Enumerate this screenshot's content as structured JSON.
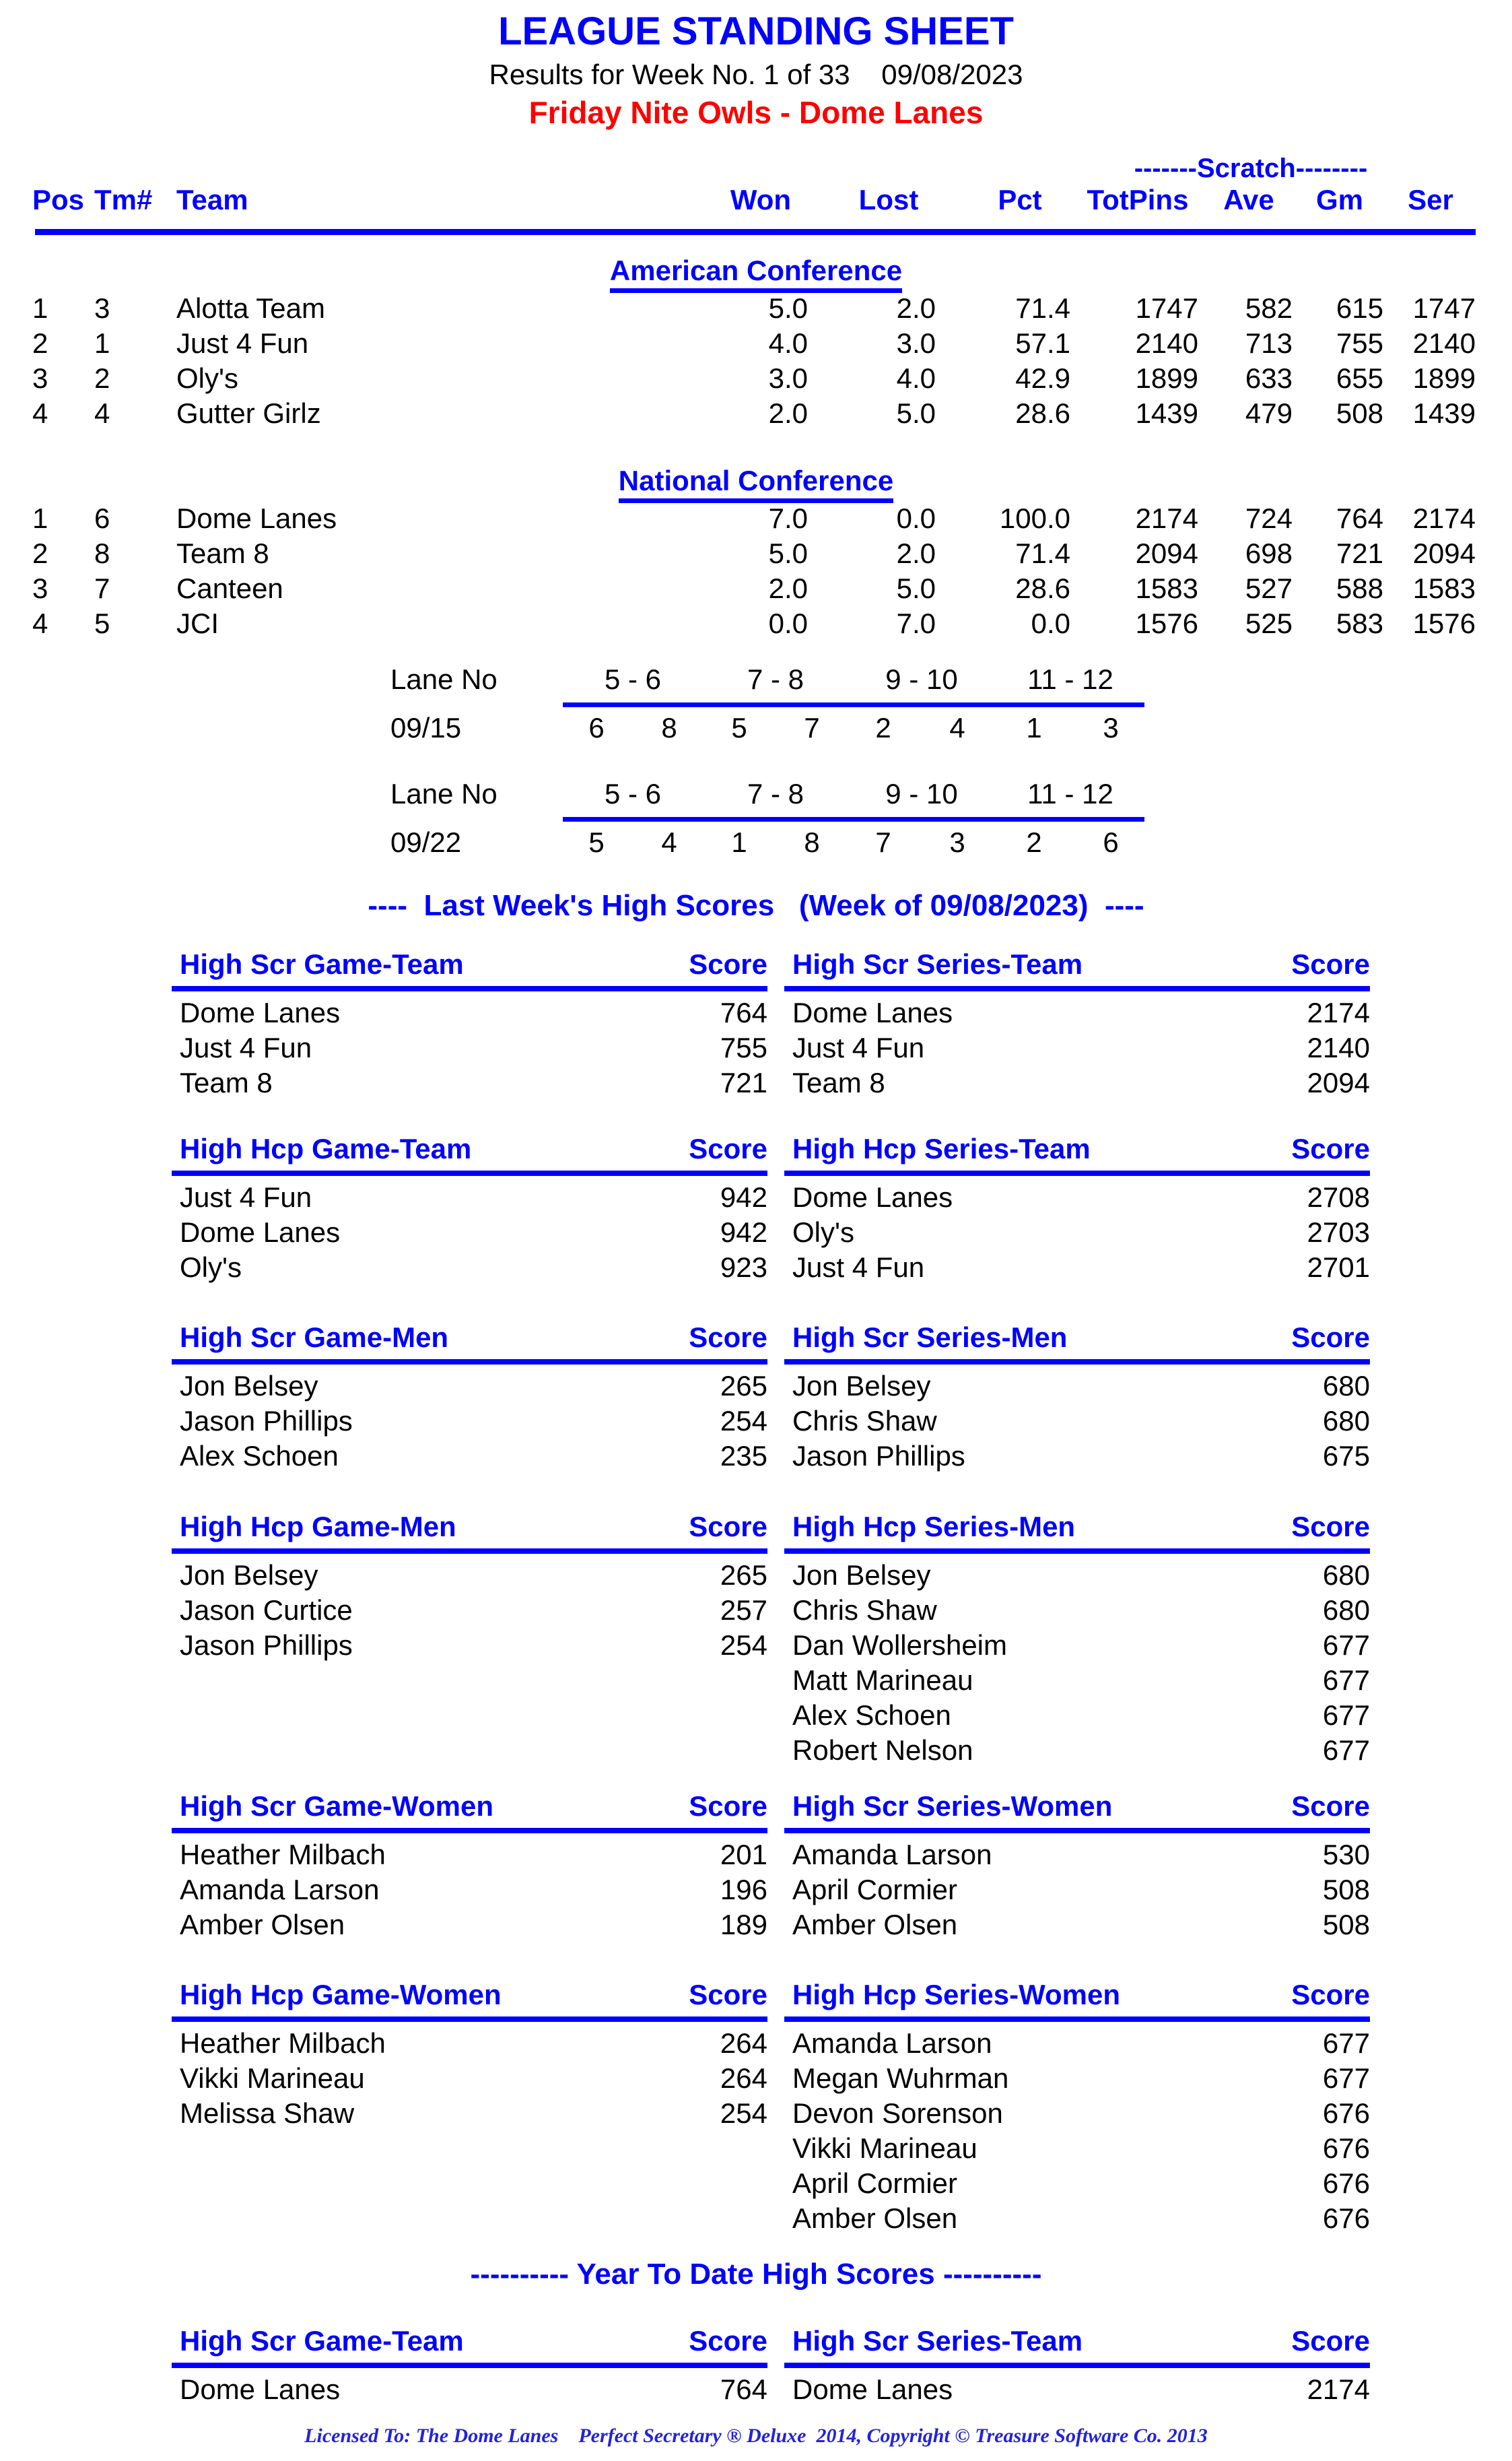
{
  "header": {
    "title": "LEAGUE STANDING SHEET",
    "subtitle": "Results for Week No. 1 of 33    09/08/2023",
    "league": "Friday Nite Owls - Dome Lanes"
  },
  "standings": {
    "scratch_label": "-------Scratch--------",
    "columns": {
      "pos": "Pos",
      "tm": "Tm#",
      "team": "Team",
      "won": "Won",
      "lost": "Lost",
      "pct": "Pct",
      "totpins": "TotPins",
      "ave": "Ave",
      "gm": "Gm",
      "ser": "Ser"
    },
    "conferences": [
      {
        "name": "American Conference",
        "rows": [
          {
            "pos": "1",
            "tm": "3",
            "team": "Alotta Team",
            "won": "5.0",
            "lost": "2.0",
            "pct": "71.4",
            "totpins": "1747",
            "ave": "582",
            "gm": "615",
            "ser": "1747"
          },
          {
            "pos": "2",
            "tm": "1",
            "team": "Just 4 Fun",
            "won": "4.0",
            "lost": "3.0",
            "pct": "57.1",
            "totpins": "2140",
            "ave": "713",
            "gm": "755",
            "ser": "2140"
          },
          {
            "pos": "3",
            "tm": "2",
            "team": "Oly's",
            "won": "3.0",
            "lost": "4.0",
            "pct": "42.9",
            "totpins": "1899",
            "ave": "633",
            "gm": "655",
            "ser": "1899"
          },
          {
            "pos": "4",
            "tm": "4",
            "team": "Gutter Girlz",
            "won": "2.0",
            "lost": "5.0",
            "pct": "28.6",
            "totpins": "1439",
            "ave": "479",
            "gm": "508",
            "ser": "1439"
          }
        ]
      },
      {
        "name": "National Conference",
        "rows": [
          {
            "pos": "1",
            "tm": "6",
            "team": "Dome Lanes",
            "won": "7.0",
            "lost": "0.0",
            "pct": "100.0",
            "totpins": "2174",
            "ave": "724",
            "gm": "764",
            "ser": "2174"
          },
          {
            "pos": "2",
            "tm": "8",
            "team": "Team 8",
            "won": "5.0",
            "lost": "2.0",
            "pct": "71.4",
            "totpins": "2094",
            "ave": "698",
            "gm": "721",
            "ser": "2094"
          },
          {
            "pos": "3",
            "tm": "7",
            "team": "Canteen",
            "won": "2.0",
            "lost": "5.0",
            "pct": "28.6",
            "totpins": "1583",
            "ave": "527",
            "gm": "588",
            "ser": "1583"
          },
          {
            "pos": "4",
            "tm": "5",
            "team": "JCI",
            "won": "0.0",
            "lost": "7.0",
            "pct": "0.0",
            "totpins": "1576",
            "ave": "525",
            "gm": "583",
            "ser": "1576"
          }
        ]
      }
    ]
  },
  "lane_schedule": [
    {
      "label": "Lane No",
      "date": "09/15",
      "pairs": [
        "5 - 6",
        "7 - 8",
        "9 - 10",
        "11 - 12"
      ],
      "teams": [
        [
          "6",
          "8"
        ],
        [
          "5",
          "7"
        ],
        [
          "2",
          "4"
        ],
        [
          "1",
          "3"
        ]
      ]
    },
    {
      "label": "Lane No",
      "date": "09/22",
      "pairs": [
        "5 - 6",
        "7 - 8",
        "9 - 10",
        "11 - 12"
      ],
      "teams": [
        [
          "5",
          "4"
        ],
        [
          "1",
          "8"
        ],
        [
          "7",
          "3"
        ],
        [
          "2",
          "6"
        ]
      ]
    }
  ],
  "last_week_banner": "----  Last Week's High Scores   (Week of 09/08/2023)  ----",
  "ytd_banner": "---------- Year To Date High Scores ----------",
  "score_header": "Score",
  "last_week_tables": [
    {
      "left": {
        "title": "High Scr Game-Team",
        "score_header": "Score",
        "rows": [
          {
            "name": "Dome Lanes",
            "score": "764"
          },
          {
            "name": "Just 4 Fun",
            "score": "755"
          },
          {
            "name": "Team 8",
            "score": "721"
          }
        ]
      },
      "right": {
        "title": "High Scr Series-Team",
        "score_header": "Score",
        "rows": [
          {
            "name": "Dome Lanes",
            "score": "2174"
          },
          {
            "name": "Just 4 Fun",
            "score": "2140"
          },
          {
            "name": "Team 8",
            "score": "2094"
          }
        ]
      }
    },
    {
      "left": {
        "title": "High Hcp Game-Team",
        "score_header": "Score",
        "rows": [
          {
            "name": "Just 4 Fun",
            "score": "942"
          },
          {
            "name": "Dome Lanes",
            "score": "942"
          },
          {
            "name": "Oly's",
            "score": "923"
          }
        ]
      },
      "right": {
        "title": "High Hcp Series-Team",
        "score_header": "Score",
        "rows": [
          {
            "name": "Dome Lanes",
            "score": "2708"
          },
          {
            "name": "Oly's",
            "score": "2703"
          },
          {
            "name": "Just 4 Fun",
            "score": "2701"
          }
        ]
      }
    },
    {
      "left": {
        "title": "High Scr Game-Men",
        "score_header": "Score",
        "rows": [
          {
            "name": "Jon Belsey",
            "score": "265"
          },
          {
            "name": "Jason Phillips",
            "score": "254"
          },
          {
            "name": "Alex Schoen",
            "score": "235"
          }
        ]
      },
      "right": {
        "title": "High Scr Series-Men",
        "score_header": "Score",
        "rows": [
          {
            "name": "Jon Belsey",
            "score": "680"
          },
          {
            "name": "Chris Shaw",
            "score": "680"
          },
          {
            "name": "Jason Phillips",
            "score": "675"
          }
        ]
      }
    },
    {
      "left": {
        "title": "High Hcp Game-Men",
        "score_header": "Score",
        "rows": [
          {
            "name": "Jon Belsey",
            "score": "265"
          },
          {
            "name": "Jason Curtice",
            "score": "257"
          },
          {
            "name": "Jason Phillips",
            "score": "254"
          }
        ]
      },
      "right": {
        "title": "High Hcp Series-Men",
        "score_header": "Score",
        "rows": [
          {
            "name": "Jon Belsey",
            "score": "680"
          },
          {
            "name": "Chris Shaw",
            "score": "680"
          },
          {
            "name": "Dan Wollersheim",
            "score": "677"
          },
          {
            "name": "Matt Marineau",
            "score": "677"
          },
          {
            "name": "Alex Schoen",
            "score": "677"
          },
          {
            "name": "Robert Nelson",
            "score": "677"
          }
        ]
      }
    },
    {
      "left": {
        "title": "High Scr Game-Women",
        "score_header": "Score",
        "rows": [
          {
            "name": "Heather Milbach",
            "score": "201"
          },
          {
            "name": "Amanda Larson",
            "score": "196"
          },
          {
            "name": "Amber Olsen",
            "score": "189"
          }
        ]
      },
      "right": {
        "title": "High Scr Series-Women",
        "score_header": "Score",
        "rows": [
          {
            "name": "Amanda Larson",
            "score": "530"
          },
          {
            "name": "April Cormier",
            "score": "508"
          },
          {
            "name": "Amber Olsen",
            "score": "508"
          }
        ]
      }
    },
    {
      "left": {
        "title": "High Hcp Game-Women",
        "score_header": "Score",
        "rows": [
          {
            "name": "Heather Milbach",
            "score": "264"
          },
          {
            "name": "Vikki Marineau",
            "score": "264"
          },
          {
            "name": "Melissa Shaw",
            "score": "254"
          }
        ]
      },
      "right": {
        "title": "High Hcp Series-Women",
        "score_header": "Score",
        "rows": [
          {
            "name": "Amanda Larson",
            "score": "677"
          },
          {
            "name": "Megan Wuhrman",
            "score": "677"
          },
          {
            "name": "Devon Sorenson",
            "score": "676"
          },
          {
            "name": "Vikki Marineau",
            "score": "676"
          },
          {
            "name": "April Cormier",
            "score": "676"
          },
          {
            "name": "Amber Olsen",
            "score": "676"
          }
        ]
      }
    }
  ],
  "ytd_tables": [
    {
      "left": {
        "title": "High Scr Game-Team",
        "score_header": "Score",
        "rows": [
          {
            "name": "Dome Lanes",
            "score": "764"
          }
        ]
      },
      "right": {
        "title": "High Scr Series-Team",
        "score_header": "Score",
        "rows": [
          {
            "name": "Dome Lanes",
            "score": "2174"
          }
        ]
      }
    }
  ],
  "footer": "Licensed To: The Dome Lanes    Perfect Secretary ® Deluxe  2014, Copyright © Treasure Software Co. 2013",
  "colors": {
    "accent_blue": "#0000ff",
    "league_red": "#ff0000",
    "text_black": "#000000",
    "footer_blue": "#2222dd"
  }
}
